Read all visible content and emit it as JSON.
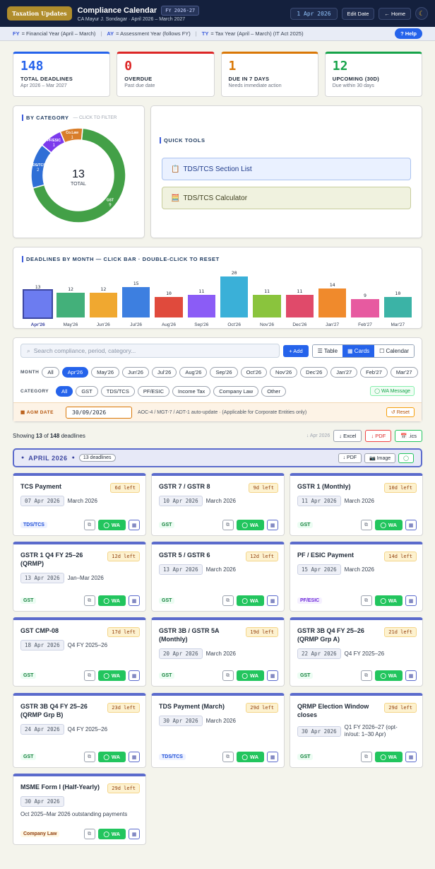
{
  "topbar": {
    "logo": "Taxation Updates",
    "title": "Compliance Calendar",
    "fy_badge": "FY 2026-27",
    "subtitle": "CA Mayur J. Sondagar · April 2026 – March 2027",
    "date": "1 Apr 2026",
    "edit_date": "Edit Date",
    "home": "← Home",
    "theme_icon": "☾"
  },
  "legend": {
    "fy_key": "FY",
    "fy_text": "= Financial Year (April – March)",
    "ay_key": "AY",
    "ay_text": "= Assessment Year (follows FY)",
    "ty_key": "TY",
    "ty_text": "= Tax Year (April – March) (IT Act 2025)",
    "help": "? Help"
  },
  "kpis": [
    {
      "value": "148",
      "label": "TOTAL DEADLINES",
      "sub": "Apr 2026 – Mar 2027",
      "color": "#2563eb"
    },
    {
      "value": "0",
      "label": "OVERDUE",
      "sub": "Past due date",
      "color": "#dc2626"
    },
    {
      "value": "1",
      "label": "DUE IN 7 DAYS",
      "sub": "Needs immediate action",
      "color": "#d97706"
    },
    {
      "value": "12",
      "label": "UPCOMING (30D)",
      "sub": "Due within 30 days",
      "color": "#16a34a"
    }
  ],
  "category": {
    "title": "BY CATEGORY",
    "hint": "— CLICK TO FILTER",
    "total": "13",
    "total_label": "TOTAL",
    "slices": [
      {
        "name": "GST",
        "value": 9,
        "color": "#43a047"
      },
      {
        "name": "TDS/TCS",
        "value": 2,
        "color": "#2f6fd6"
      },
      {
        "name": "PF/ESIC",
        "value": 1,
        "color": "#7c3aed"
      },
      {
        "name": "Co.Law",
        "value": 1,
        "color": "#d97e2a"
      }
    ]
  },
  "tools": {
    "title": "QUICK TOOLS",
    "items": [
      {
        "icon": "📋",
        "label": "TDS/TCS Section List"
      },
      {
        "icon": "🧮",
        "label": "TDS/TCS Calculator"
      }
    ]
  },
  "chart_data": {
    "type": "bar",
    "title": "DEADLINES BY MONTH — CLICK BAR · DOUBLE-CLICK TO RESET",
    "categories": [
      "Apr'26",
      "May'26",
      "Jun'26",
      "Jul'26",
      "Aug'26",
      "Sep'26",
      "Oct'26",
      "Nov'26",
      "Dec'26",
      "Jan'27",
      "Feb'27",
      "Mar'27"
    ],
    "values": [
      13,
      12,
      12,
      15,
      10,
      11,
      20,
      11,
      11,
      14,
      9,
      10
    ],
    "colors": [
      "#6c7cf0",
      "#43b07a",
      "#f0a830",
      "#3d7fe0",
      "#e04a3c",
      "#8b5cf6",
      "#3ab0d8",
      "#8ac43d",
      "#e04a6a",
      "#f08a2c",
      "#e75aa0",
      "#3bb3a6"
    ],
    "ylim": [
      0,
      20
    ]
  },
  "filters": {
    "search_placeholder": "Search compliance, period, category...",
    "add": "+ Add",
    "views": [
      "☰ Table",
      "▦ Cards",
      "☐ Calendar"
    ],
    "month_label": "MONTH",
    "months": [
      "All",
      "Apr'26",
      "May'26",
      "Jun'26",
      "Jul'26",
      "Aug'26",
      "Sep'26",
      "Oct'26",
      "Nov'26",
      "Dec'26",
      "Jan'27",
      "Feb'27",
      "Mar'27"
    ],
    "category_label": "CATEGORY",
    "categories": [
      "All",
      "GST",
      "TDS/TCS",
      "PF/ESIC",
      "Income Tax",
      "Company Law",
      "Other"
    ],
    "wa_message": "◯ WA Message",
    "agm_label": "AGM DATE",
    "agm_value": "30/09/2026",
    "agm_note": "AOC-4 / MGT-7 / ADT-1 auto-update · (Applicable for Corporate Entities only)",
    "reset": "↺ Reset"
  },
  "results": {
    "showing_prefix": "Showing",
    "shown": "13",
    "of": "of",
    "total": "148",
    "suffix": "deadlines",
    "month_tag": "↓ Apr 2026",
    "excel": "↓ Excel",
    "pdf": "↓ PDF",
    "ics": "📅 .ics"
  },
  "month_group": {
    "title": "APRIL 2026",
    "count": "13 deadlines",
    "pdf": "↓ PDF",
    "image": "📷 Image"
  },
  "cards": [
    {
      "title": "TCS Payment",
      "days": "6d left",
      "date": "07 Apr 2026",
      "period": "March 2026",
      "cat": "TDS/TCS",
      "cls": "cat-tds"
    },
    {
      "title": "GSTR 7 / GSTR 8",
      "days": "9d left",
      "date": "10 Apr 2026",
      "period": "March 2026",
      "cat": "GST",
      "cls": "cat-gst"
    },
    {
      "title": "GSTR 1 (Monthly)",
      "days": "10d left",
      "date": "11 Apr 2026",
      "period": "March 2026",
      "cat": "GST",
      "cls": "cat-gst"
    },
    {
      "title": "GSTR 1 Q4 FY 25–26 (QRMP)",
      "days": "12d left",
      "date": "13 Apr 2026",
      "period": "Jan–Mar 2026",
      "cat": "GST",
      "cls": "cat-gst"
    },
    {
      "title": "GSTR 5 / GSTR 6",
      "days": "12d left",
      "date": "13 Apr 2026",
      "period": "March 2026",
      "cat": "GST",
      "cls": "cat-gst"
    },
    {
      "title": "PF / ESIC Payment",
      "days": "14d left",
      "date": "15 Apr 2026",
      "period": "March 2026",
      "cat": "PF/ESIC",
      "cls": "cat-pf"
    },
    {
      "title": "GST CMP-08",
      "days": "17d left",
      "date": "18 Apr 2026",
      "period": "Q4 FY 2025–26",
      "cat": "GST",
      "cls": "cat-gst"
    },
    {
      "title": "GSTR 3B / GSTR 5A (Monthly)",
      "days": "19d left",
      "date": "20 Apr 2026",
      "period": "March 2026",
      "cat": "GST",
      "cls": "cat-gst"
    },
    {
      "title": "GSTR 3B Q4 FY 25–26 (QRMP Grp A)",
      "days": "21d left",
      "date": "22 Apr 2026",
      "period": "Q4 FY 2025–26",
      "cat": "GST",
      "cls": "cat-gst"
    },
    {
      "title": "GSTR 3B Q4 FY 25–26 (QRMP Grp B)",
      "days": "23d left",
      "date": "24 Apr 2026",
      "period": "Q4 FY 2025–26",
      "cat": "GST",
      "cls": "cat-gst"
    },
    {
      "title": "TDS Payment (March)",
      "days": "29d left",
      "date": "30 Apr 2026",
      "period": "March 2026",
      "cat": "TDS/TCS",
      "cls": "cat-tds"
    },
    {
      "title": "QRMP Election Window closes",
      "days": "29d left",
      "date": "30 Apr 2026",
      "period": "Q1 FY 2026–27 (opt-in/out: 1–30 Apr)",
      "cat": "GST",
      "cls": "cat-gst"
    },
    {
      "title": "MSME Form I (Half-Yearly)",
      "days": "29d left",
      "date": "30 Apr 2026",
      "period": "Oct 2025–Mar 2026 outstanding payments",
      "cat": "Company Law",
      "cls": "cat-law"
    }
  ],
  "card_actions": {
    "copy_icon": "⧉",
    "wa": "WA",
    "wa_icon": "◯",
    "cal_icon": "▦"
  }
}
